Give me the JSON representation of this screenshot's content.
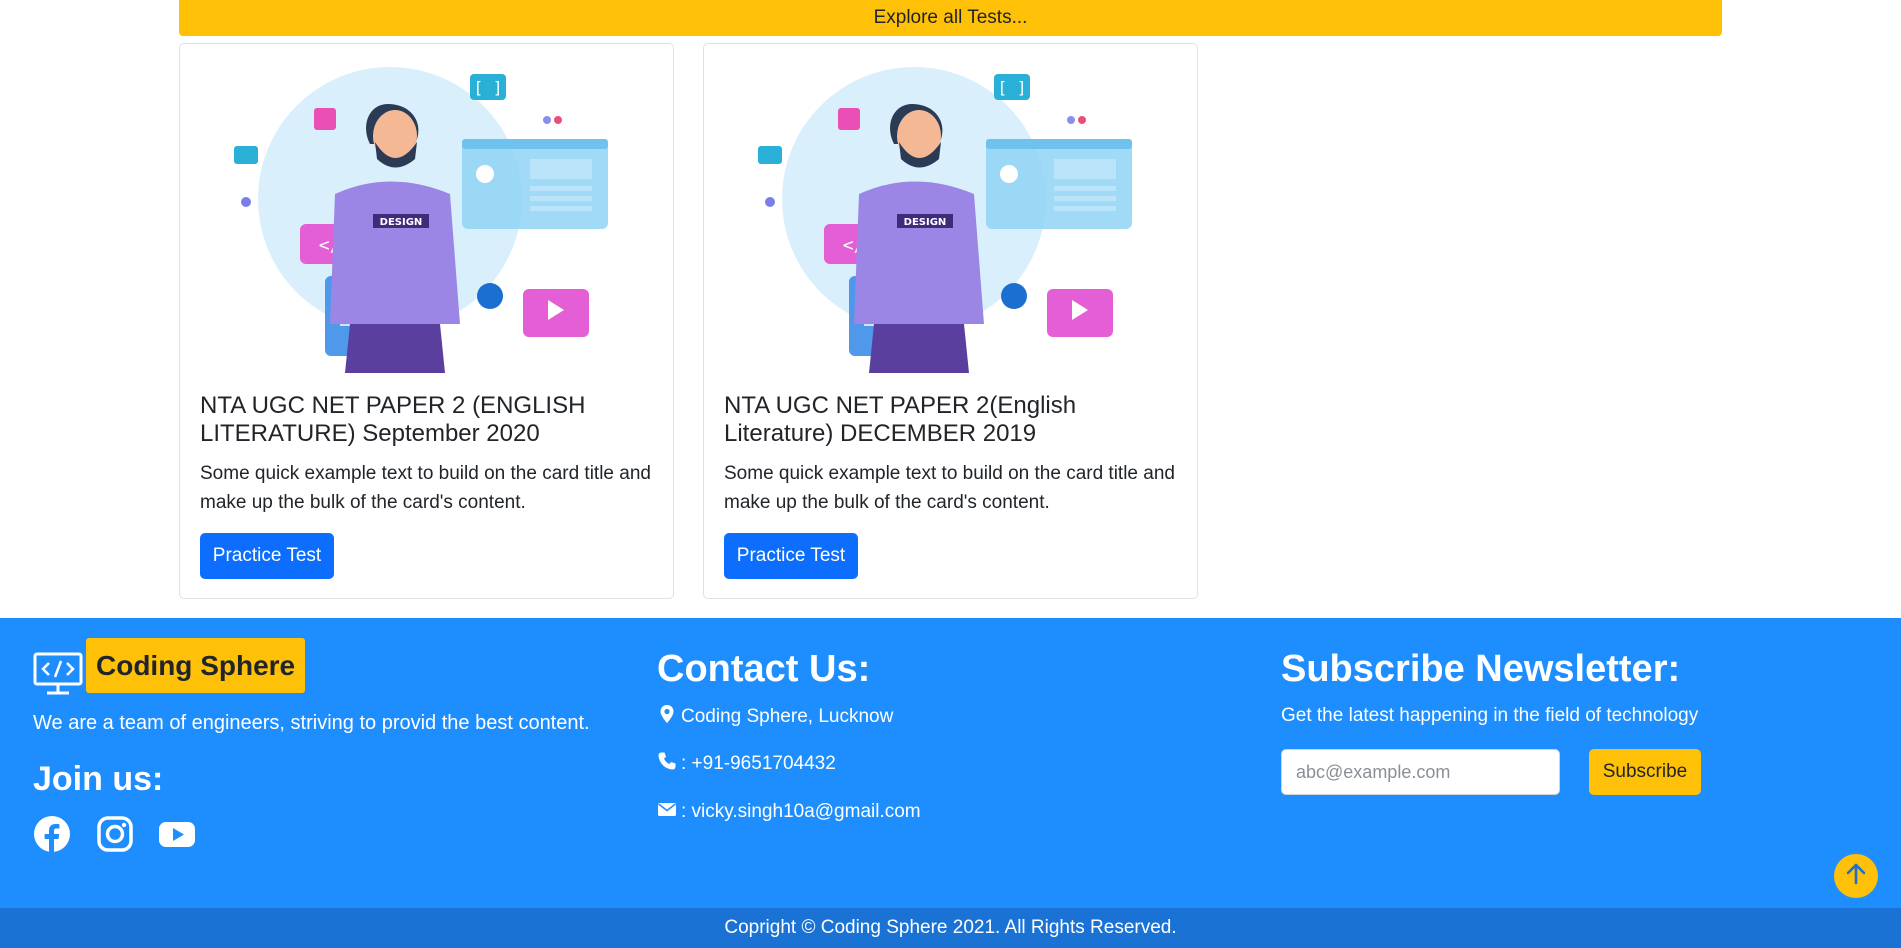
{
  "explore": {
    "label": "Explore all Tests..."
  },
  "cards": [
    {
      "title": "NTA UGC NET PAPER 2 (ENGLISH LITERATURE) September 2020",
      "text": "Some quick example text to build on the card title and make up the bulk of the card's content.",
      "button": "Practice Test",
      "badge": "DESIGN"
    },
    {
      "title": "NTA UGC NET PAPER 2(English Literature) DECEMBER 2019",
      "text": "Some quick example text to build on the card title and make up the bulk of the card's content.",
      "button": "Practice Test",
      "badge": "DESIGN"
    }
  ],
  "footer": {
    "brand": "Coding Sphere",
    "about": "We are a team of engineers, striving to provid the best content.",
    "join_heading": "Join us:",
    "social_icons": [
      "facebook-icon",
      "instagram-icon",
      "youtube-icon"
    ],
    "contact": {
      "heading": "Contact Us:",
      "address": "Coding Sphere, Lucknow",
      "phone": ": +91-9651704432",
      "email": ": vicky.singh10a@gmail.com"
    },
    "newsletter": {
      "heading": "Subscribe Newsletter:",
      "subtitle": "Get the latest happening in the field of technology",
      "placeholder": "abc@example.com",
      "button": "Subscribe"
    },
    "copyright": "Copright © Coding Sphere 2021. All Rights Reserved."
  },
  "colors": {
    "accent_yellow": "#ffc107",
    "primary_blue": "#0d6efd",
    "footer_blue": "#1e8eff",
    "copyright_blue": "#1a73d4"
  }
}
